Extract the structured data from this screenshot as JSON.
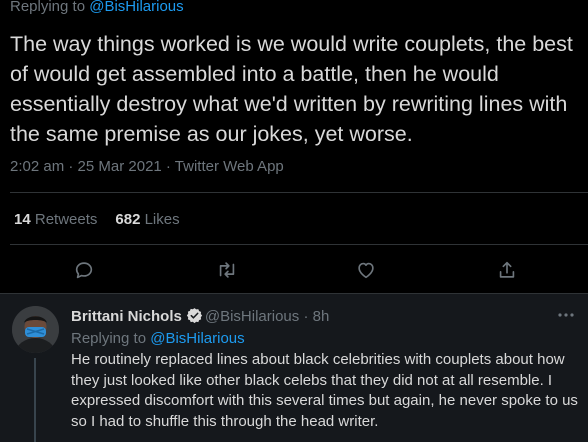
{
  "main_tweet": {
    "replying_prefix": "Replying to ",
    "replying_handle": "@BisHilarious",
    "text": "The way things worked is we would write couplets, the best of would get assembled into a battle, then he would essentially destroy what we'd written by rewriting lines with the same premise as our jokes, yet worse.",
    "meta": "2:02 am · 25 Mar 2021 · Twitter Web App",
    "retweets_count": "14",
    "retweets_label": " Retweets",
    "likes_count": "682",
    "likes_label": " Likes",
    "actions": [
      "reply-icon",
      "retweet-icon",
      "like-icon",
      "share-icon"
    ]
  },
  "reply_tweet": {
    "name": "Brittani Nichols",
    "handle_time": "@BisHilarious · 8h",
    "replying_prefix": "Replying to ",
    "replying_handle": "@BisHilarious",
    "text": "He routinely replaced lines about black celebrities with couplets about how they just looked like other black celebs that they did not at all resemble. I expressed discomfort with this several times but again, he never spoke to us so I had to shuffle this through the head writer."
  },
  "colors": {
    "background": "#000000",
    "reply_background": "#15181c",
    "text": "#d9d9d9",
    "muted": "#6e767d",
    "link": "#1d9bf0",
    "divider": "#2f3336"
  }
}
